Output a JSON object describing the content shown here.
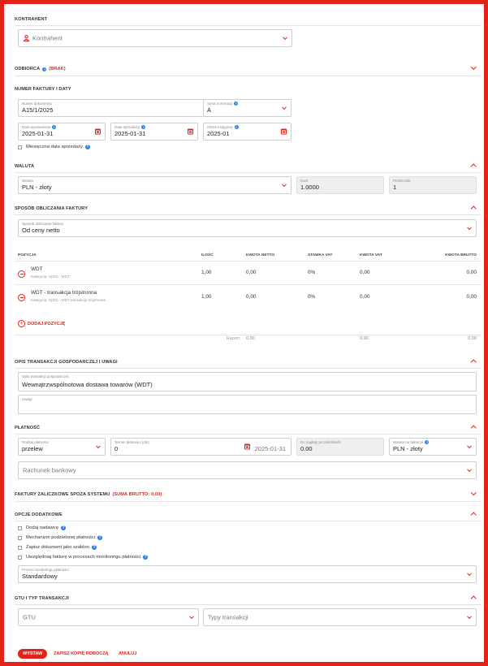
{
  "contractor": {
    "section_title": "Kontrahent",
    "placeholder": "Kontrahent"
  },
  "recipient": {
    "section_title": "Odbiorca",
    "badge": "(BRAK)"
  },
  "invoice_number": {
    "section_title": "Numer faktury i daty",
    "doc_number_label": "Numer dokumentu",
    "doc_number_value": "A15/1/2025",
    "series_label": "Seria numeracji",
    "series_value": "A",
    "issue_date_label": "Data wystawienia",
    "issue_date_value": "2025-01-31",
    "sale_date_label": "Data sprzedaży",
    "sale_date_value": "2025-01-31",
    "period_label": "Okres księgowy",
    "period_value": "2025-01",
    "monthly_sale_label": "Miesięczna data sprzedaży"
  },
  "currency": {
    "section_title": "Waluta",
    "currency_label": "Waluta",
    "currency_value": "PLN - złoty",
    "rate_label": "Kurs",
    "rate_value": "1.0000",
    "converter_label": "Przelicznik",
    "converter_value": "1"
  },
  "calculation": {
    "section_title": "Sposób obliczania faktury",
    "method_label": "Sposób obliczania faktury",
    "method_value": "Od ceny netto"
  },
  "positions": {
    "headers": {
      "position": "Pozycja",
      "qty": "Ilość",
      "net": "Kwota netto",
      "vat_rate": "Stawka VAT",
      "vat": "Kwota VAT",
      "gross": "Kwota brutto"
    },
    "rows": [
      {
        "name": "WDT",
        "category": "Kategoria: S(ZS) - WDT",
        "qty": "1,00",
        "net": "0,00",
        "vat_rate": "0%",
        "vat": "0,00",
        "gross": "0,00"
      },
      {
        "name": "WDT - transakcja trójstronna",
        "category": "Kategoria: S(ZS) - WDT transakcja trójstronna",
        "qty": "1,00",
        "net": "0,00",
        "vat_rate": "0%",
        "vat": "0,00",
        "gross": "0,00"
      }
    ],
    "add_label": "Dodaj pozycję",
    "totals": {
      "label": "Razem:",
      "net": "0,00",
      "vat": "0,00",
      "gross": "0,00"
    }
  },
  "description": {
    "section_title": "Opis transakcji gospodarczej i uwagi",
    "desc_label": "Opis transakcji gospodarczej",
    "desc_value": "Wewnątrzwspólnotowa dostawa towarów  (WDT)",
    "notes_label": "Uwagi"
  },
  "payment": {
    "section_title": "Płatność",
    "method_label": "Rodzaj płatności",
    "method_value": "przelew",
    "term_label": "Termin płatności (dni)",
    "term_value": "0",
    "due_date_value": "2025-01-31",
    "remaining_label": "Do zapłaty po zaliczkach",
    "remaining_value": "0.00",
    "currency_label": "Waluta na fakturze",
    "currency_value": "PLN - złoty",
    "bank_placeholder": "Rachunek bankowy"
  },
  "advance_invoices": {
    "section_title": "Faktury zaliczkowe spoza systemu",
    "badge": "(SUMA BRUTTO: 0,00)"
  },
  "additional": {
    "section_title": "Opcje dodatkowe",
    "options": [
      "Dodaj nadawcę",
      "Mechanizm podzielonej płatności",
      "Zapisz dokument jako szablon",
      "Uwzględniaj fakturę w procesach monitoringu płatności"
    ],
    "monitoring_label": "Proces monitoringu płatności",
    "monitoring_value": "Standardowy"
  },
  "transaction": {
    "section_title": "GTU i typ transakcji",
    "gtu_placeholder": "GTU",
    "type_placeholder": "Typy transakcji"
  },
  "actions": {
    "issue": "Wystaw",
    "save_draft": "Zapisz kopię roboczą",
    "cancel": "Anuluj"
  },
  "colors": {
    "accent": "#e2231a",
    "help": "#2a7de1"
  }
}
